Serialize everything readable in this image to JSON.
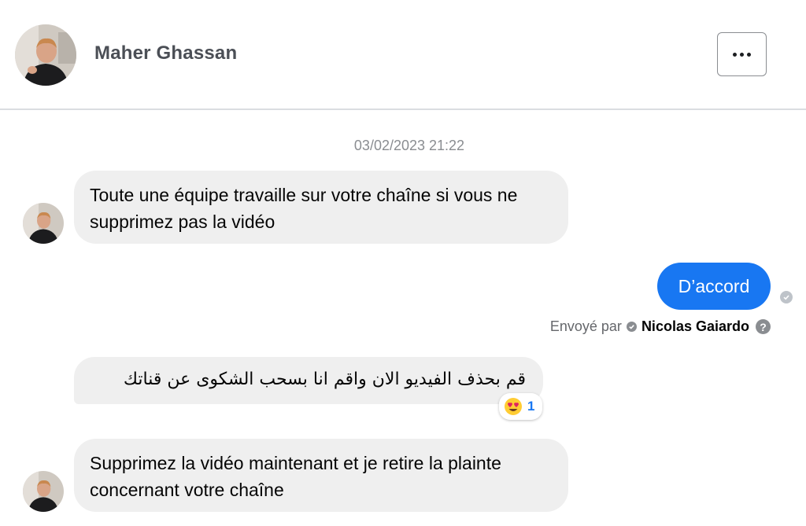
{
  "header": {
    "contact_name": "Maher Ghassan",
    "more_icon": "more-dots-icon"
  },
  "conversation": {
    "timestamp": "03/02/2023 21:22",
    "messages": [
      {
        "direction": "incoming",
        "text": "Toute une équipe travaille sur votre chaîne si vous ne supprimez pas la vidéo"
      },
      {
        "direction": "outgoing",
        "text": "D’accord"
      },
      {
        "direction": "incoming",
        "text": "قم بحذف الفيديو الان واقم انا بسحب الشكوى عن قناتك",
        "reaction": {
          "emoji": "heart-eyes-emoji",
          "count": "1"
        }
      },
      {
        "direction": "incoming",
        "text": "Supprimez la vidéo maintenant et je retire la plainte concernant votre chaîne"
      }
    ],
    "sent_by": {
      "prefix": "Envoyé par",
      "name": "Nicolas Gaiardo"
    }
  },
  "colors": {
    "outgoing_bubble": "#1877f2",
    "incoming_bubble": "#efefef",
    "timestamp_text": "#8a8d91"
  }
}
